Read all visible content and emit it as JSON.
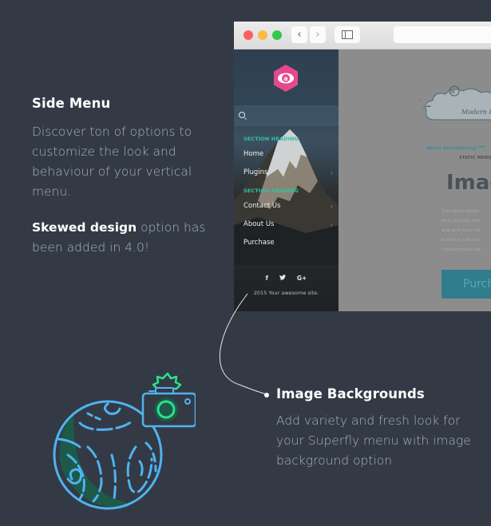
{
  "side_menu_section": {
    "title": "Side Menu",
    "description": "Discover ton of options to customize the look and behaviour of your vertical menu.",
    "skewed_bold": "Skewed design",
    "skewed_rest": " option has been added in 4.0!"
  },
  "browser": {
    "nav_back_label": "‹",
    "nav_forward_label": "›",
    "url": ""
  },
  "menu": {
    "search_placeholder": "",
    "section_heading_1": "SECTION HEADING",
    "section_heading_2": "SECTION HEADING",
    "items": [
      {
        "label": "Home",
        "has_submenu": false
      },
      {
        "label": "Plugins",
        "has_submenu": true
      },
      {
        "label": "Contact Us",
        "has_submenu": true
      },
      {
        "label": "About Us",
        "has_submenu": true
      },
      {
        "label": "Purchase",
        "has_submenu": false
      }
    ],
    "chevron": "›",
    "social": {
      "facebook": "f",
      "twitter": "🐦",
      "google": "G+"
    },
    "copyright": "2015 Your awesome site."
  },
  "page": {
    "tagline": "Modern &",
    "subheading": "IMAGE BACKGROUND",
    "subheading_badge": "NEW",
    "static_label": "STATIC MENU",
    "title": "Imag",
    "demo_lines": [
      "This demo showc",
      "Now you can add",
      "and split your me",
      "button in left corn",
      "improvements we"
    ],
    "purchase_label": "Purch"
  },
  "image_bg_section": {
    "title": "Image Backgrounds",
    "description": "Add variety and fresh look for your Superfly menu with image background option"
  },
  "colors": {
    "background": "#333a45",
    "accent_teal": "#2ec4a0",
    "logo_pink": "#e6488f",
    "illustration_blue": "#4fb3f0",
    "illustration_green": "#2ee08a"
  }
}
